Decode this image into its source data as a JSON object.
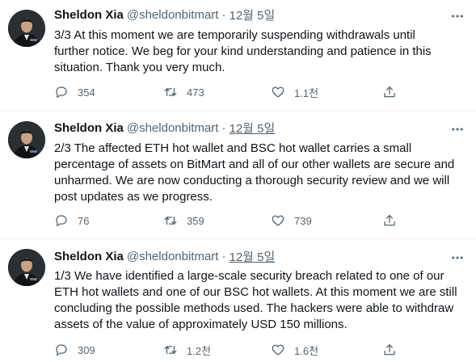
{
  "tweets": [
    {
      "author": "Sheldon Xia",
      "handle": "@sheldonbitmart",
      "separator": "·",
      "time": "12월 5일",
      "lines": [
        "3/3  At this moment we are temporarily suspending withdrawals until",
        "further notice. We beg for your kind understanding and patience in this",
        "situation.  Thank you very much."
      ],
      "replies": "354",
      "retweets": "473",
      "likes": "1.1천"
    },
    {
      "author": "Sheldon Xia",
      "handle": "@sheldonbitmart",
      "separator": "·",
      "time": "12월 5일",
      "lines": [
        "2/3 The affected ETH hot wallet and BSC hot wallet carries a small",
        "percentage of assets on BitMart and all of our other wallets are secure and",
        "unharmed. We are now conducting a thorough security review and we will",
        "post updates as we progress."
      ],
      "replies": "76",
      "retweets": "359",
      "likes": "739"
    },
    {
      "author": "Sheldon Xia",
      "handle": "@sheldonbitmart",
      "separator": "·",
      "time": "12월 5일",
      "lines": [
        "1/3 We have identified a large-scale security breach related to one of our",
        "ETH hot wallets and one of our BSC hot wallets. At this moment we are still",
        "concluding the possible methods used. The hackers were able to withdraw",
        "assets of the value of approximately USD 150 millions."
      ],
      "replies": "309",
      "retweets": "1.2천",
      "likes": "1.6천"
    }
  ],
  "icons": {
    "reply": "reply-icon",
    "retweet": "retweet-icon",
    "like": "heart-icon",
    "share": "share-icon",
    "more": "more-icon"
  },
  "colors": {
    "text": "#0f1419",
    "secondary": "#536471",
    "divider": "#eff3f4",
    "background": "#ffffff"
  }
}
